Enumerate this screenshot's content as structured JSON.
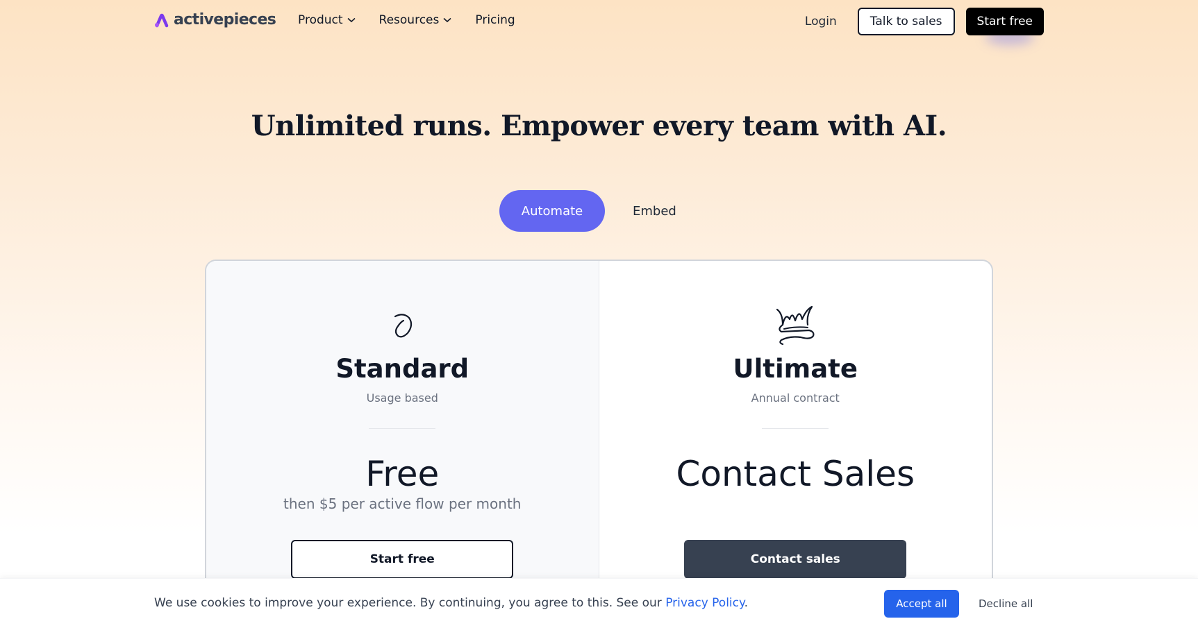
{
  "nav": {
    "logo_text": "activepieces",
    "links": [
      {
        "label": "Product",
        "has_dropdown": true
      },
      {
        "label": "Resources",
        "has_dropdown": true
      },
      {
        "label": "Pricing",
        "has_dropdown": false
      }
    ],
    "login": "Login",
    "talk_to_sales": "Talk to sales",
    "start_free": "Start free"
  },
  "hero": {
    "headline": "Unlimited runs. Empower every team with AI."
  },
  "toggle": {
    "options": [
      "Automate",
      "Embed"
    ],
    "selected": "Automate"
  },
  "plans": [
    {
      "name": "Standard",
      "subtitle": "Usage based",
      "price": "Free",
      "price_note": "then $5 per active flow per month",
      "cta": "Start free",
      "icon": "swirl-icon"
    },
    {
      "name": "Ultimate",
      "subtitle": "Annual contract",
      "price": "Contact Sales",
      "price_note": "",
      "cta": "Contact sales",
      "icon": "crown-icon"
    }
  ],
  "cookie": {
    "text": "We use cookies to improve your experience. By continuing, you agree to this. See our ",
    "link": "Privacy Policy",
    "period": ".",
    "accept": "Accept all",
    "decline": "Decline all"
  },
  "colors": {
    "accent": "#6366f1",
    "primary_blue": "#2563eb",
    "dark_button": "#374151"
  }
}
